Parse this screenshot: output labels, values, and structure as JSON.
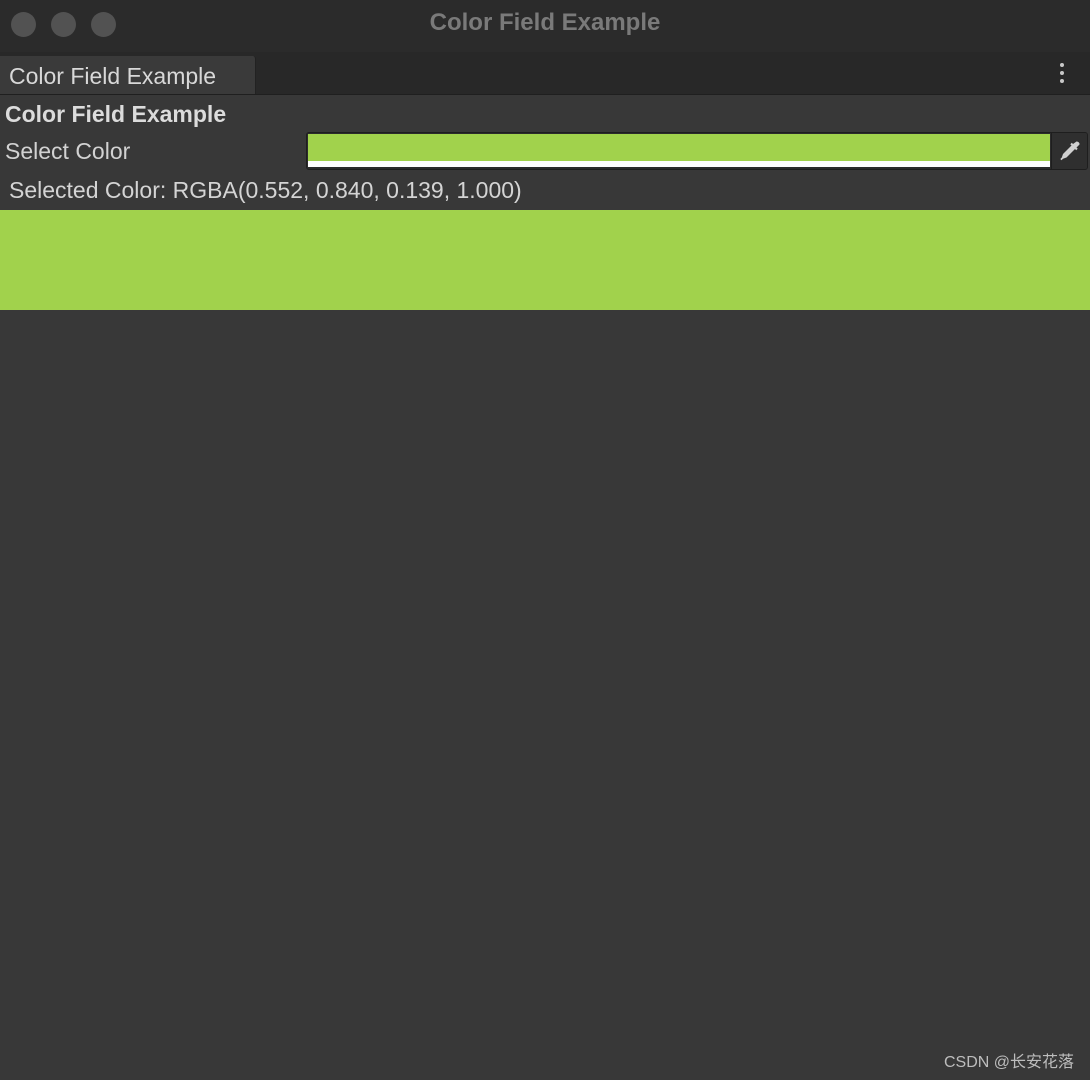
{
  "window": {
    "title": "Color Field Example"
  },
  "tab": {
    "label": "Color Field Example"
  },
  "content": {
    "header": "Color Field Example",
    "color_field_label": "Select Color",
    "selected_color_text": "Selected Color: RGBA(0.552, 0.840, 0.139, 1.000)"
  },
  "colors": {
    "selected": "#a1d24c",
    "background": "#383838",
    "titlebar": "#2b2b2b"
  },
  "icons": {
    "window_buttons": [
      "close-icon",
      "minimize-icon",
      "zoom-icon"
    ],
    "menu": "kebab-menu-icon",
    "picker": "eyedropper-icon"
  },
  "watermark": "CSDN @长安花落"
}
